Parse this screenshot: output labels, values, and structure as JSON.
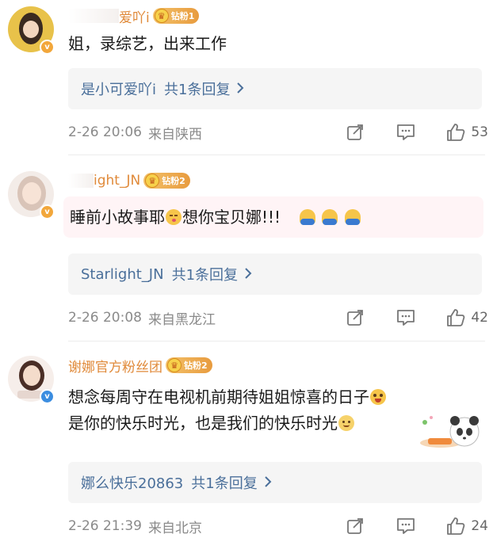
{
  "comments": [
    {
      "username": "是小可爱吖i",
      "username_visible": "爱吖i",
      "badge": "钻粉1",
      "text": "姐，录综艺，出来工作",
      "reply": {
        "user": "是小可爱吖i",
        "count_text": "共1条回复"
      },
      "time": "2-26 20:06",
      "location": "来自陕西",
      "likes": "53",
      "verified_color": "#f2a73b"
    },
    {
      "username": "Starlight_JN",
      "username_visible": "ight_JN",
      "badge": "钻粉2",
      "text_before": "睡前小故事耶",
      "text_after": "想你宝贝娜!!!",
      "reply": {
        "user": "Starlight_JN",
        "count_text": "共1条回复"
      },
      "time": "2-26 20:08",
      "location": "来自黑龙江",
      "likes": "42",
      "verified_color": "#f2a73b"
    },
    {
      "username": "谢娜官方粉丝团",
      "badge": "钻粉2",
      "line1": "想念每周守在电视机前期待姐姐惊喜的日子",
      "line2": "是你的快乐时光，也是我们的快乐时光",
      "reply": {
        "user": "娜么快乐20863",
        "count_text": "共1条回复"
      },
      "time": "2-26 21:39",
      "location": "来自北京",
      "likes": "24",
      "verified_color": "#3b8de0"
    }
  ],
  "icons": {
    "share": "share-icon",
    "comment": "comment-icon",
    "like": "thumbs-up-icon",
    "chevron": "chevron-right-icon"
  }
}
